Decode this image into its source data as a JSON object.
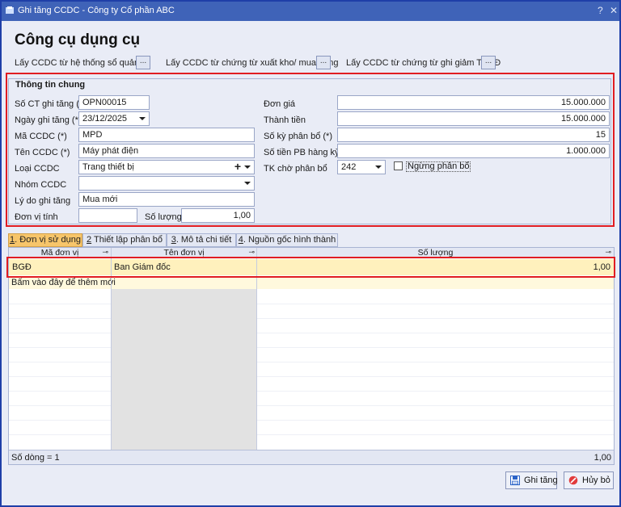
{
  "window": {
    "title": "Ghi tăng CCDC - Công ty Cổ phần ABC",
    "help_label": "?",
    "close_label": "✕"
  },
  "page_title": "Công cụ dụng cụ",
  "links": {
    "from_system": "Lấy CCDC từ hệ thống sổ quản trị",
    "from_issue": "Lấy CCDC từ chứng từ xuất kho/ mua hàng",
    "from_tscd": "Lấy CCDC từ chứng từ ghi giảm TSCĐ",
    "picker_label": "..."
  },
  "general": {
    "title": "Thông tin chung",
    "doc_no": {
      "label": "Số CT ghi tăng (*)",
      "value": "OPN00015"
    },
    "date": {
      "label": "Ngày ghi tăng (*)",
      "value": "23/12/2025"
    },
    "code": {
      "label": "Mã CCDC (*)",
      "value": "MPD"
    },
    "name": {
      "label": "Tên CCDC (*)",
      "value": "Máy phát điện"
    },
    "type": {
      "label": "Loại CCDC",
      "value": "Trang thiết bị"
    },
    "group": {
      "label": "Nhóm CCDC",
      "value": ""
    },
    "reason": {
      "label": "Lý do ghi tăng",
      "value": "Mua mới"
    },
    "unit": {
      "label": "Đơn vị tính",
      "value": ""
    },
    "qty": {
      "label": "Số lượng",
      "value": "1,00"
    },
    "unit_price": {
      "label": "Đơn giá",
      "value": "15.000.000"
    },
    "amount": {
      "label": "Thành tiền",
      "value": "15.000.000"
    },
    "periods": {
      "label": "Số kỳ phân bổ (*)",
      "value": "15"
    },
    "per_period": {
      "label": "Số tiền PB hàng kỳ",
      "value": "1.000.000"
    },
    "pending_acc": {
      "label": "TK chờ phân bổ",
      "value": "242"
    },
    "stop_alloc": {
      "label": "Ngừng phân bổ",
      "checked": false
    }
  },
  "tabs": [
    {
      "key": "1",
      "label": ". Đơn vị sử dụng",
      "active": true
    },
    {
      "key": "2",
      "label": " Thiết lập phân bổ",
      "active": false
    },
    {
      "key": "3",
      "label": ". Mô tả chi tiết",
      "active": false
    },
    {
      "key": "4",
      "label": ". Nguồn gốc hình thành",
      "active": false
    }
  ],
  "grid": {
    "columns": [
      "Mã đơn vị",
      "Tên đơn vị",
      "Số lượng"
    ],
    "pin_icon": "pin-icon",
    "rows": [
      {
        "code": "BGĐ",
        "name": "Ban Giám đốc",
        "qty": "1,00"
      }
    ],
    "add_hint": "Bấm vào đây để thêm mới",
    "footer_count": "Số dòng = 1",
    "footer_total": "1,00"
  },
  "buttons": {
    "save": "Ghi tăng",
    "cancel": "Hủy bỏ"
  },
  "colors": {
    "title_bar": "#3f63b8",
    "highlight": "#e11d22",
    "active_tab": "#f7c56a",
    "selected_row": "#fff1bd"
  }
}
